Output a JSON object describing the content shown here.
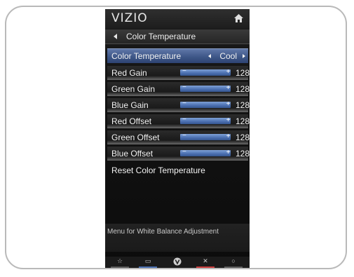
{
  "header": {
    "logo": "VIZIO",
    "home_icon": "home-icon"
  },
  "breadcrumb": {
    "back_icon": "back-arrow-icon",
    "label": "Color Temperature"
  },
  "menu": {
    "selected": {
      "label": "Color Temperature",
      "value": "Cool"
    },
    "sliders": [
      {
        "label": "Red Gain",
        "value": "128",
        "level": 1.0
      },
      {
        "label": "Green Gain",
        "value": "128",
        "level": 1.0
      },
      {
        "label": "Blue Gain",
        "value": "128",
        "level": 1.0
      },
      {
        "label": "Red Offset",
        "value": "128",
        "level": 1.0
      },
      {
        "label": "Green Offset",
        "value": "128",
        "level": 1.0
      },
      {
        "label": "Blue Offset",
        "value": "128",
        "level": 1.0
      }
    ],
    "slider_minus": "−",
    "slider_plus": "+",
    "reset_label": "Reset Color Temperature"
  },
  "description": "Menu for White Balance Adjustment",
  "bottom_bar": {
    "buttons": [
      {
        "icon": "star-icon",
        "glyph": "☆",
        "color": "#8a8a8a"
      },
      {
        "icon": "menu-icon",
        "glyph": "▭",
        "color": "#4a6fb0"
      },
      {
        "icon": "vizio-v-icon",
        "glyph": "V",
        "color": "#9a9a9a"
      },
      {
        "icon": "exit-icon",
        "glyph": "✕",
        "color": "#c83b3b"
      },
      {
        "icon": "info-icon",
        "glyph": "○",
        "color": "#8a8a8a"
      }
    ]
  },
  "colors": {
    "selected_row": "#4a63a0",
    "slider_fill": "#4a6fb0",
    "screen_bg": "#141414"
  }
}
